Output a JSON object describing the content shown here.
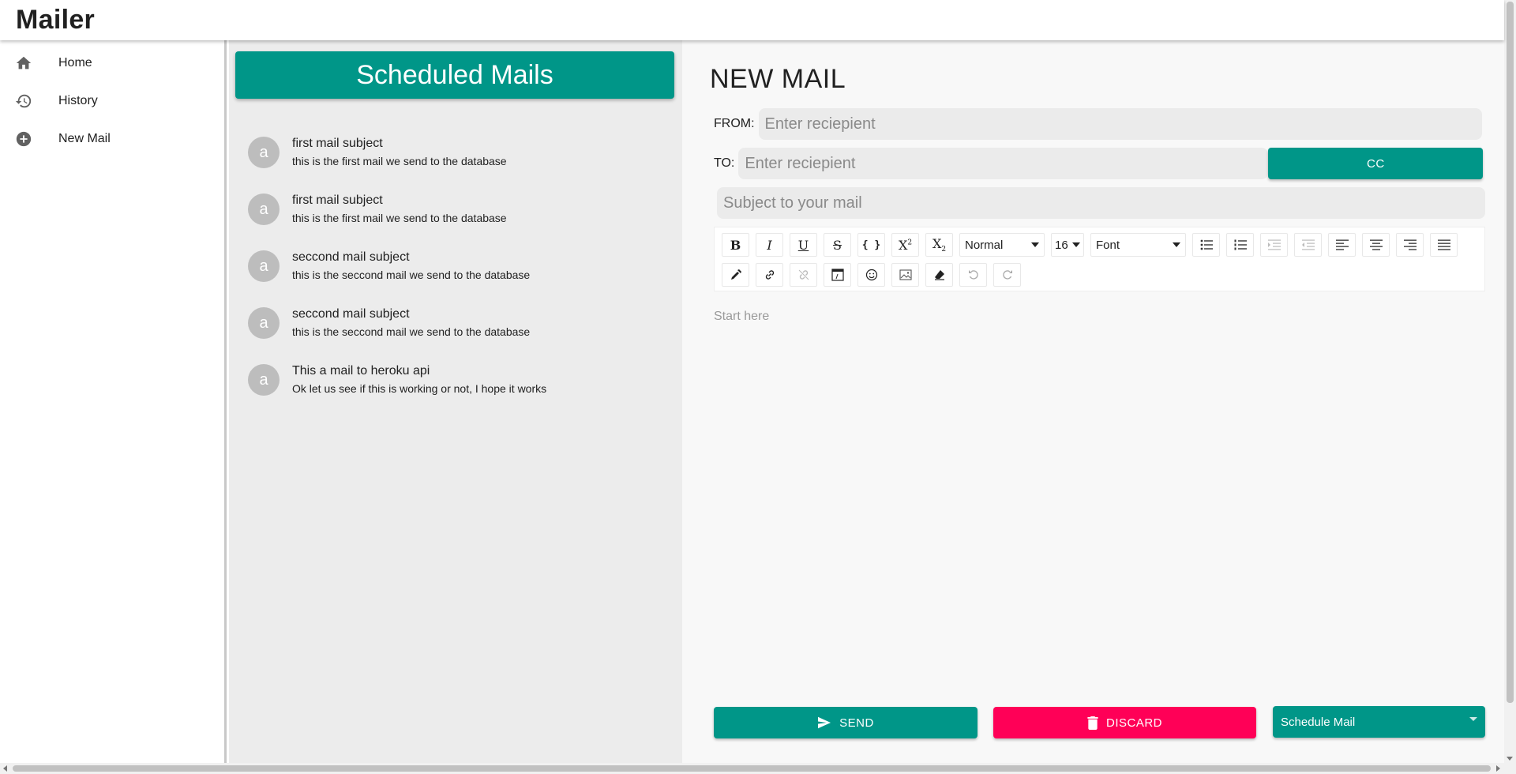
{
  "app": {
    "title": "Mailer"
  },
  "sidebar": {
    "items": [
      {
        "label": "Home",
        "icon": "home-icon"
      },
      {
        "label": "History",
        "icon": "history-icon"
      },
      {
        "label": "New Mail",
        "icon": "add-circle-icon"
      }
    ]
  },
  "scheduled": {
    "title": "Scheduled Mails",
    "mails": [
      {
        "avatar": "a",
        "subject": "first mail subject",
        "body": "this is the first mail we send to the database"
      },
      {
        "avatar": "a",
        "subject": "first mail subject",
        "body": "this is the first mail we send to the database"
      },
      {
        "avatar": "a",
        "subject": "seccond mail subject",
        "body": "this is the seccond mail we send to the database"
      },
      {
        "avatar": "a",
        "subject": "seccond mail subject",
        "body": "this is the seccond mail we send to the database"
      },
      {
        "avatar": "a",
        "subject": "This a mail to heroku api",
        "body": "Ok let us see if this is working or not, I hope it works"
      }
    ]
  },
  "compose": {
    "title": "NEW MAIL",
    "from_label": "FROM:",
    "from_placeholder": "Enter reciepient",
    "from_value": "",
    "to_label": "TO:",
    "to_placeholder": "Enter reciepient",
    "to_value": "",
    "cc_label": "CC",
    "subject_placeholder": "Subject to your mail",
    "subject_value": "",
    "editor_placeholder": "Start here",
    "toolbar": {
      "block_type": "Normal",
      "font_size": "16",
      "font_family": "Font"
    },
    "send_label": "SEND",
    "discard_label": "DISCARD",
    "schedule_label": "Schedule Mail"
  },
  "colors": {
    "primary": "#009688",
    "danger": "#ff0057",
    "panel_bg": "#ececec",
    "compose_bg": "#f8f8f8"
  }
}
